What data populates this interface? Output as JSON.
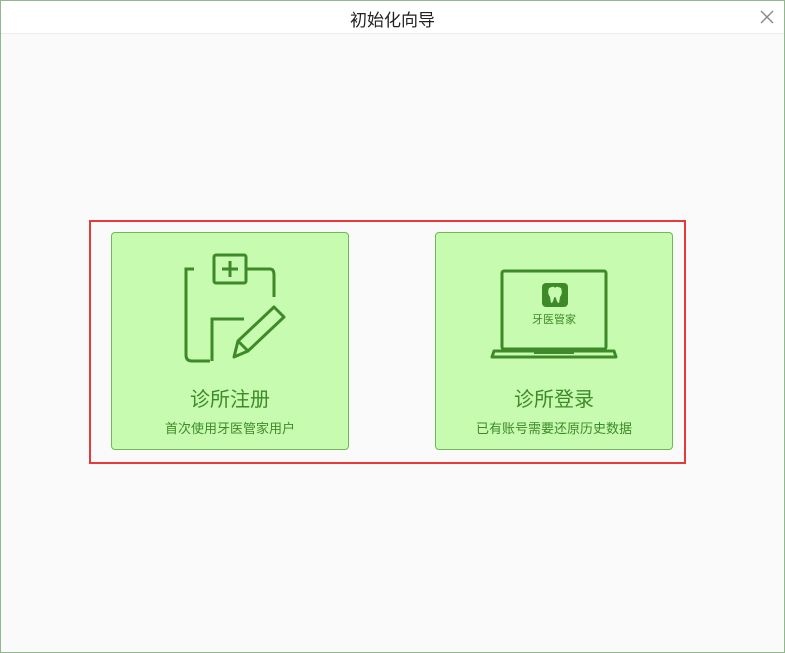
{
  "window": {
    "title": "初始化向导"
  },
  "cards": [
    {
      "id": "register",
      "title": "诊所注册",
      "subtitle": "首次使用牙医管家用户",
      "icon": "clipboard-edit-icon"
    },
    {
      "id": "login",
      "title": "诊所登录",
      "subtitle": "已有账号需要还原历史数据",
      "icon": "laptop-icon",
      "screen_label": "牙医管家"
    }
  ],
  "colors": {
    "accent_green": "#3f8a28",
    "card_bg": "#c6fbb0",
    "card_border": "#6fba56",
    "highlight_border": "#e53a3a",
    "window_border": "#8fb98b"
  }
}
